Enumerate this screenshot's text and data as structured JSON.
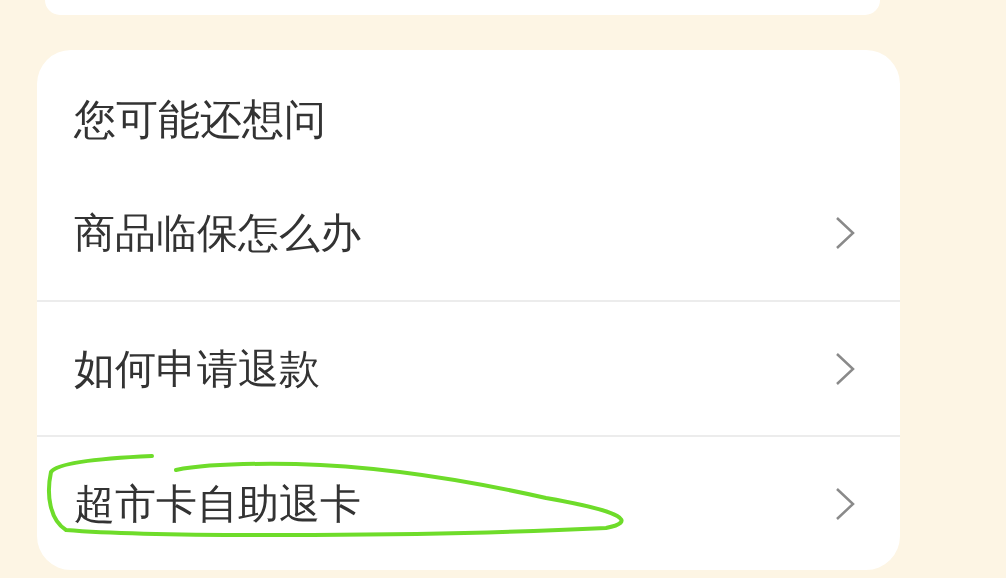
{
  "title": "您可能还想问",
  "questions": [
    {
      "text": "商品临保怎么办"
    },
    {
      "text": "如何申请退款"
    },
    {
      "text": "超市卡自助退卡"
    }
  ]
}
